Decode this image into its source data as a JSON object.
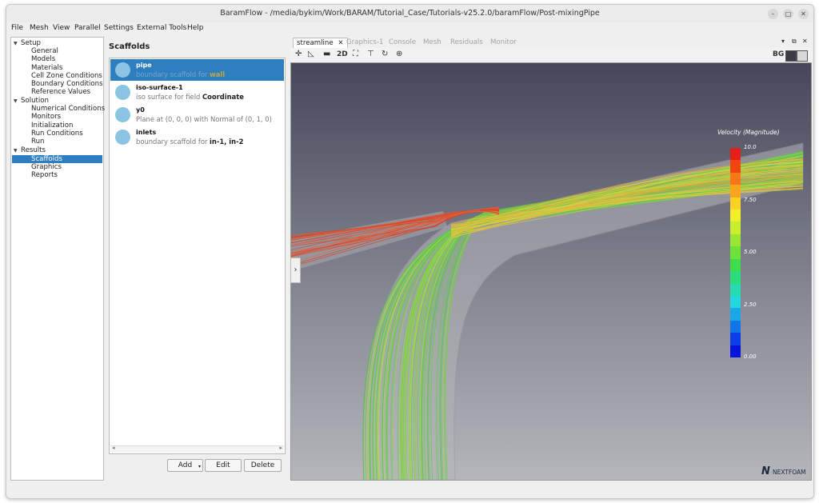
{
  "window": {
    "title": "BaramFlow - /media/bykim/Work/BARAM/Tutorial_Case/Tutorials-v25.2.0/baramFlow/Post-mixingPipe"
  },
  "menu": [
    "File",
    "Mesh",
    "View",
    "Parallel",
    "Settings",
    "External Tools",
    "Help"
  ],
  "tree": {
    "setup": "Setup",
    "setup_items": [
      "General",
      "Models",
      "Materials",
      "Cell Zone Conditions",
      "Boundary Conditions",
      "Reference Values"
    ],
    "solution": "Solution",
    "solution_items": [
      "Numerical Conditions",
      "Monitors",
      "Initialization",
      "Run Conditions",
      "Run"
    ],
    "results": "Results",
    "results_items": [
      "Scaffolds",
      "Graphics",
      "Reports"
    ]
  },
  "scaffolds": {
    "title": "Scaffolds",
    "items": [
      {
        "name": "pipe",
        "desc": "boundary scaffold for ",
        "bold": "wall"
      },
      {
        "name": "iso-surface-1",
        "desc": "iso surface for field ",
        "bold": "Coordinate"
      },
      {
        "name": "y0",
        "desc": "Plane at (0, 0, 0) with Normal of (0, 1, 0)",
        "bold": ""
      },
      {
        "name": "inlets",
        "desc": "boundary scaffold for ",
        "bold": "in-1, in-2"
      }
    ],
    "buttons": {
      "add": "Add",
      "edit": "Edit",
      "delete": "Delete"
    }
  },
  "tabs": [
    "streamline",
    "Graphics-1",
    "Console",
    "Mesh",
    "Residuals",
    "Monitor"
  ],
  "toolbar": {
    "mode_2d": "2D",
    "bg": "BG"
  },
  "legend": {
    "title": "Velocity (Magnitude)",
    "labels": [
      "10.0",
      "7.50",
      "5.00",
      "2.50",
      "0.00"
    ],
    "colors": [
      "#e32019",
      "#f2440f",
      "#f7761a",
      "#fba51f",
      "#fbd223",
      "#f1ef26",
      "#c8ee2c",
      "#9ae632",
      "#6ee23a",
      "#3edd4a",
      "#2bdc7c",
      "#26dbb0",
      "#21d7e0",
      "#1aa7e8",
      "#1274e9",
      "#0a3fea",
      "#0515dd"
    ]
  },
  "brand": {
    "logo_text": "NEXTFOAM"
  }
}
